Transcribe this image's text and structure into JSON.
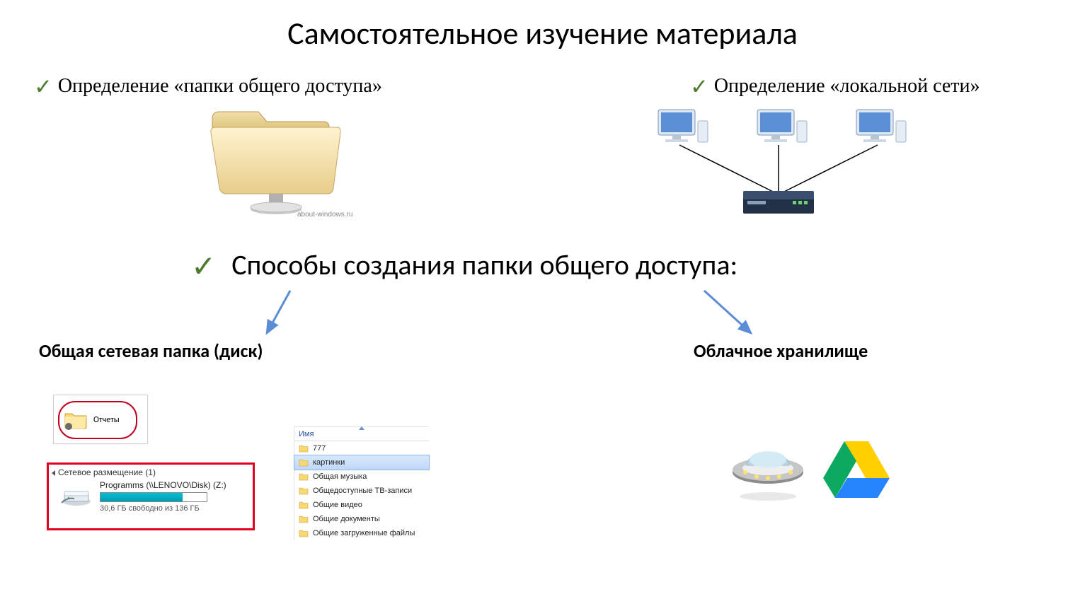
{
  "title": "Самостоятельное изучение материала",
  "bullets": {
    "shared_folder_def": "Определение «папки общего доступа»",
    "lan_def": "Определение «локальной сети»",
    "ways": "Способы создания папки общего доступа:"
  },
  "folder_credit": "about-windows.ru",
  "subheads": {
    "network_share": "Общая сетевая папка (диск)",
    "cloud": "Облачное хранилище"
  },
  "report_folder_label": "Отчеты",
  "network_location": {
    "header": "Сетевое размещение (1)",
    "drive_name": "Programms (\\\\LENOVO\\Disk) (Z:)",
    "free_text": "30,6 ГБ свободно из 136 ГБ",
    "used_percent": 77
  },
  "explorer": {
    "column": "Имя",
    "items": [
      {
        "label": "777",
        "selected": false
      },
      {
        "label": "картинки",
        "selected": true
      },
      {
        "label": "Общая музыка",
        "selected": false
      },
      {
        "label": "Общедоступные ТВ-записи",
        "selected": false
      },
      {
        "label": "Общие видео",
        "selected": false
      },
      {
        "label": "Общие документы",
        "selected": false
      },
      {
        "label": "Общие загруженные файлы",
        "selected": false
      }
    ]
  },
  "icons": {
    "checkmark": "check-icon",
    "shared_folder": "shared-folder-icon",
    "lan_diagram": "lan-network-icon",
    "arrow": "arrow-icon",
    "report_folder": "folder-share-icon",
    "drive": "network-drive-icon",
    "folder_small": "folder-icon",
    "ufo": "yandex-disk-ufo-icon",
    "gdrive": "google-drive-icon"
  },
  "colors": {
    "check": "#4a7a2a",
    "arrow": "#5b8cd6",
    "highlight_border": "#e00020",
    "gdrive_green": "#0da960",
    "gdrive_yellow": "#ffcf00",
    "gdrive_blue": "#2684fc"
  }
}
